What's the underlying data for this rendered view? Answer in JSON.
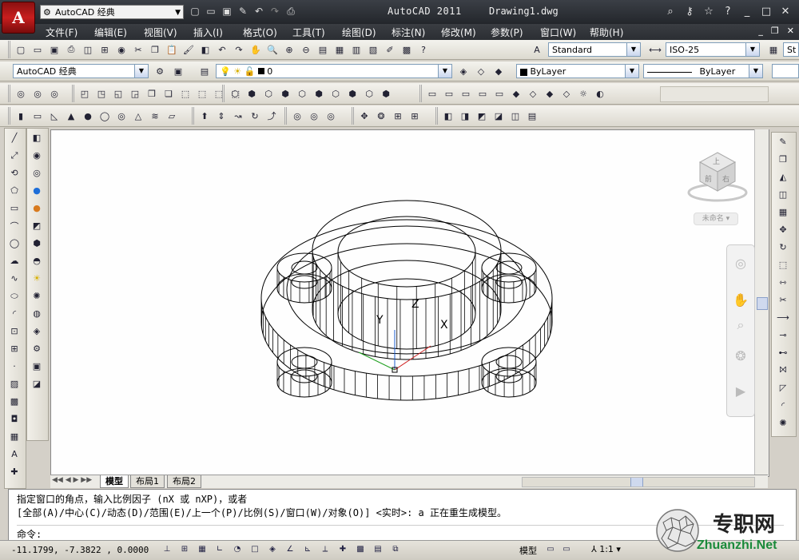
{
  "app": {
    "button_letter": "A",
    "workspace": "AutoCAD 经典",
    "title": "AutoCAD 2011",
    "document": "Drawing1.dwg"
  },
  "menu": [
    "文件(F)",
    "编辑(E)",
    "视图(V)",
    "插入(I)",
    "格式(O)",
    "工具(T)",
    "绘图(D)",
    "标注(N)",
    "修改(M)",
    "参数(P)",
    "窗口(W)",
    "帮助(H)"
  ],
  "toolbar": {
    "text_style": "Standard",
    "dim_style": "ISO-25",
    "workspace_select": "AutoCAD 经典",
    "layer": "0",
    "color": "ByLayer",
    "linetype": "ByLayer",
    "right_cut": "St"
  },
  "viewcube": {
    "top": "上",
    "front": "前",
    "right": "右",
    "wcs": "未命名"
  },
  "layout_tabs": [
    "模型",
    "布局1",
    "布局2"
  ],
  "command": {
    "line1": "指定窗口的角点，输入比例因子 (nX 或 nXP)，或者",
    "line2": "[全部(A)/中心(C)/动态(D)/范围(E)/上一个(P)/比例(S)/窗口(W)/对象(O)] <实时>: a 正在重生成模型。",
    "prompt": "命令:"
  },
  "status": {
    "coords": "-11.1799, -7.3822 , 0.0000",
    "model": "模型",
    "scale": "1:1",
    "watermark": "专职网",
    "watermark_url": "Zhuanzhi.Net"
  },
  "axis": {
    "z": "Z",
    "y": "Y",
    "x": "X"
  },
  "colors": {
    "title_bg": "#23262b",
    "canvas": "#fefefe",
    "accent": "#c81e1e"
  }
}
